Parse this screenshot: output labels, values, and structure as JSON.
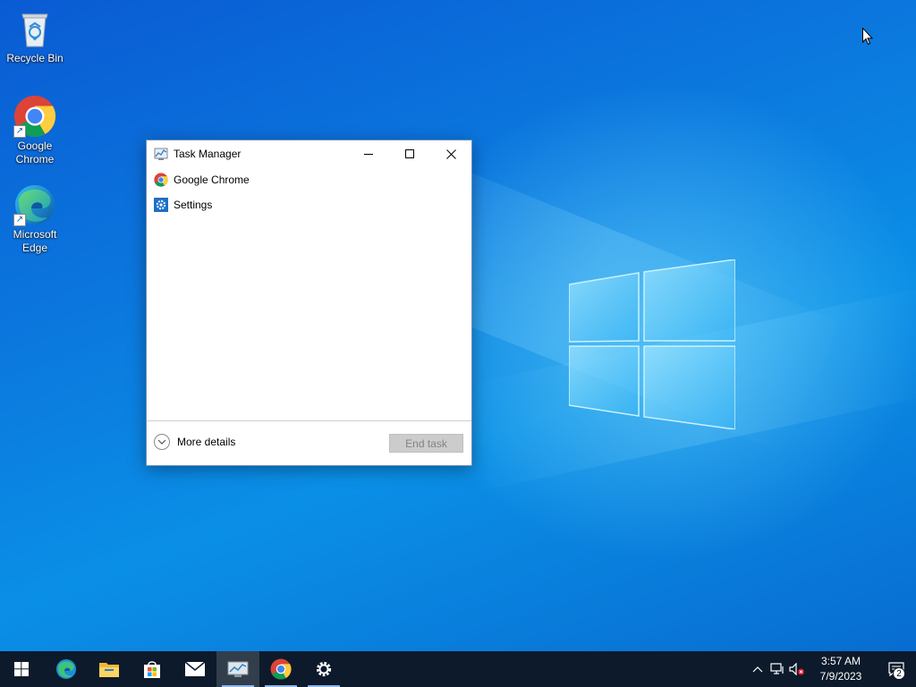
{
  "desktop": {
    "icons": [
      {
        "label": "Recycle Bin",
        "icon": "recycle-bin-icon"
      },
      {
        "label": "Google Chrome",
        "icon": "chrome-icon",
        "shortcut": true
      },
      {
        "label": "Microsoft Edge",
        "icon": "edge-icon",
        "shortcut": true
      }
    ]
  },
  "task_manager": {
    "title": "Task Manager",
    "apps": [
      {
        "name": "Google Chrome",
        "icon": "chrome-icon"
      },
      {
        "name": "Settings",
        "icon": "settings-gear-icon"
      }
    ],
    "more_details_label": "More details",
    "end_task_label": "End task"
  },
  "taskbar": {
    "pinned": [
      {
        "name": "Microsoft Edge",
        "icon": "edge-icon"
      },
      {
        "name": "File Explorer",
        "icon": "folder-icon"
      },
      {
        "name": "Microsoft Store",
        "icon": "store-icon"
      },
      {
        "name": "Mail",
        "icon": "mail-icon"
      },
      {
        "name": "Task Manager",
        "icon": "task-manager-icon",
        "active": true
      },
      {
        "name": "Google Chrome",
        "icon": "chrome-icon",
        "running": true
      },
      {
        "name": "Settings",
        "icon": "gear-icon",
        "running": true
      }
    ],
    "clock": {
      "time": "3:57 AM",
      "date": "7/9/2023"
    },
    "notification_count": "2"
  },
  "colors": {
    "taskbar_bg": "#0c1a2b",
    "desktop_accent": "#0a7de0",
    "running_indicator": "#8fb8e8"
  }
}
